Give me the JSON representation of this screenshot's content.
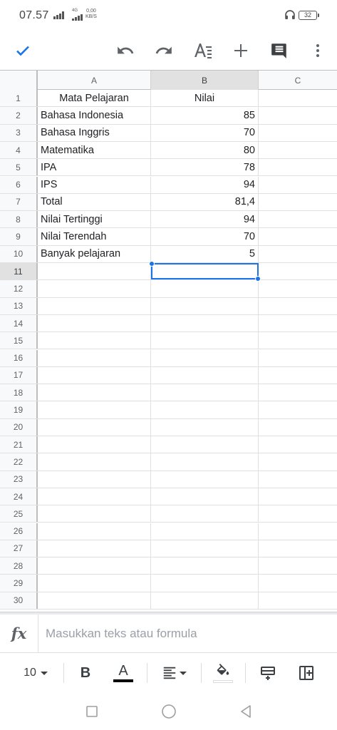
{
  "status_bar": {
    "time": "07.57",
    "network_type": "4G",
    "net_speed_value": "0,00",
    "net_speed_unit": "KB/S",
    "battery": "32"
  },
  "toolbar": {
    "icons": [
      "check-icon",
      "undo-icon",
      "redo-icon",
      "text-format-icon",
      "add-icon",
      "comment-icon",
      "more-vert-icon"
    ]
  },
  "sheet": {
    "columns": [
      "A",
      "B",
      "C"
    ],
    "selected_column": "B",
    "selected_row": "11",
    "selected_cell": "B11",
    "rows": [
      {
        "num": "1",
        "a": "Mata Pelajaran",
        "b": "Nilai",
        "c": ""
      },
      {
        "num": "2",
        "a": "Bahasa Indonesia",
        "b": "85",
        "c": ""
      },
      {
        "num": "3",
        "a": "Bahasa Inggris",
        "b": "70",
        "c": ""
      },
      {
        "num": "4",
        "a": "Matematika",
        "b": "80",
        "c": ""
      },
      {
        "num": "5",
        "a": "IPA",
        "b": "78",
        "c": ""
      },
      {
        "num": "6",
        "a": "IPS",
        "b": "94",
        "c": ""
      },
      {
        "num": "7",
        "a": "Total",
        "b": "81,4",
        "c": ""
      },
      {
        "num": "8",
        "a": "Nilai Tertinggi",
        "b": "94",
        "c": ""
      },
      {
        "num": "9",
        "a": "Nilai Terendah",
        "b": "70",
        "c": ""
      },
      {
        "num": "10",
        "a": "Banyak pelajaran",
        "b": "5",
        "c": ""
      },
      {
        "num": "11",
        "a": "",
        "b": "",
        "c": ""
      },
      {
        "num": "12",
        "a": "",
        "b": "",
        "c": ""
      },
      {
        "num": "13",
        "a": "",
        "b": "",
        "c": ""
      },
      {
        "num": "14",
        "a": "",
        "b": "",
        "c": ""
      },
      {
        "num": "15",
        "a": "",
        "b": "",
        "c": ""
      },
      {
        "num": "16",
        "a": "",
        "b": "",
        "c": ""
      },
      {
        "num": "17",
        "a": "",
        "b": "",
        "c": ""
      },
      {
        "num": "18",
        "a": "",
        "b": "",
        "c": ""
      },
      {
        "num": "19",
        "a": "",
        "b": "",
        "c": ""
      },
      {
        "num": "20",
        "a": "",
        "b": "",
        "c": ""
      },
      {
        "num": "21",
        "a": "",
        "b": "",
        "c": ""
      },
      {
        "num": "22",
        "a": "",
        "b": "",
        "c": ""
      },
      {
        "num": "23",
        "a": "",
        "b": "",
        "c": ""
      },
      {
        "num": "24",
        "a": "",
        "b": "",
        "c": ""
      },
      {
        "num": "25",
        "a": "",
        "b": "",
        "c": ""
      },
      {
        "num": "26",
        "a": "",
        "b": "",
        "c": ""
      },
      {
        "num": "27",
        "a": "",
        "b": "",
        "c": ""
      },
      {
        "num": "28",
        "a": "",
        "b": "",
        "c": ""
      },
      {
        "num": "29",
        "a": "",
        "b": "",
        "c": ""
      },
      {
        "num": "30",
        "a": "",
        "b": "",
        "c": ""
      }
    ]
  },
  "formula_bar": {
    "placeholder": "Masukkan teks atau formula",
    "value": ""
  },
  "format_bar": {
    "font_size": "10",
    "bold_label": "B",
    "text_color_label": "A",
    "icons": [
      "bold-icon",
      "text-color-icon",
      "align-icon",
      "fill-color-icon",
      "insert-row-icon",
      "insert-column-icon"
    ]
  },
  "colors": {
    "accent": "#1a73e8",
    "header_bg": "#f8f9fa",
    "selected_header_bg": "#e1e1e1",
    "gridline": "#e0e0e0"
  }
}
